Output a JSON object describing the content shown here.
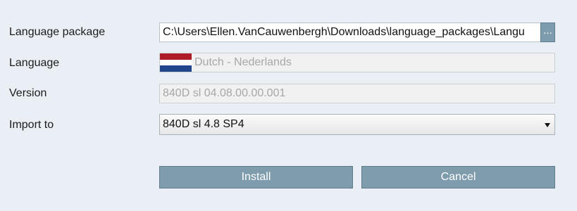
{
  "form": {
    "package_label": "Language package",
    "package_path": "C:\\Users\\Ellen.VanCauwenbergh\\Downloads\\language_packages\\Langu",
    "browse_label": "...",
    "language_label": "Language",
    "language_value": "Dutch - Nederlands",
    "language_flag_icon": "netherlands-flag-icon",
    "version_label": "Version",
    "version_value": "840D sl 04.08.00.00.001",
    "import_label": "Import to",
    "import_value": "840D sl 4.8 SP4"
  },
  "actions": {
    "install_label": "Install",
    "cancel_label": "Cancel"
  },
  "colors": {
    "background": "#e9eff5",
    "button": "#7e9cac",
    "flag_red": "#ae1c28",
    "flag_white": "#ffffff",
    "flag_blue": "#21468b"
  }
}
